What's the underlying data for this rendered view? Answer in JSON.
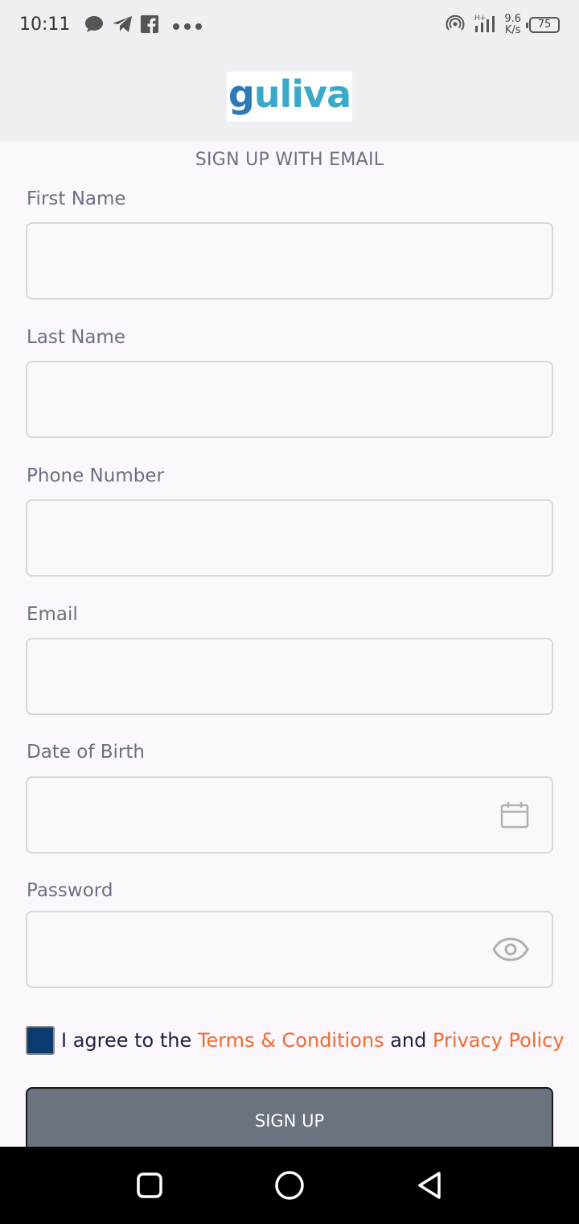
{
  "status_bar": {
    "time": "10:11",
    "net_speed_value": "9.6",
    "net_speed_unit": "K/s",
    "battery": "75",
    "icons": [
      "chat-icon",
      "telegram-icon",
      "facebook-icon",
      "more-dots-icon",
      "hotspot-icon",
      "signal-icon",
      "battery-icon"
    ]
  },
  "header": {
    "logo_text_first": "g",
    "logo_text_rest": "uliva"
  },
  "form": {
    "title": "SIGN UP WITH EMAIL",
    "fields": [
      {
        "label": "First Name",
        "value": ""
      },
      {
        "label": "Last Name",
        "value": ""
      },
      {
        "label": "Phone Number",
        "value": ""
      },
      {
        "label": "Email",
        "value": ""
      },
      {
        "label": "Date of Birth",
        "value": "",
        "icon": "calendar-icon"
      },
      {
        "label": "Password",
        "value": "",
        "icon": "eye-icon"
      }
    ],
    "agree": {
      "prefix": "I agree to the ",
      "terms": "Terms & Conditions",
      "middle": " and ",
      "privacy": "Privacy Policy",
      "checked": true
    },
    "submit_label": "SIGN UP"
  },
  "colors": {
    "accent_link": "#ef6c2e",
    "checkbox": "#0b3a6e",
    "button_bg": "#6b7280",
    "logo_blue": "#3aa9c9"
  },
  "nav": {
    "icons": [
      "recents-icon",
      "home-icon",
      "back-icon"
    ]
  }
}
